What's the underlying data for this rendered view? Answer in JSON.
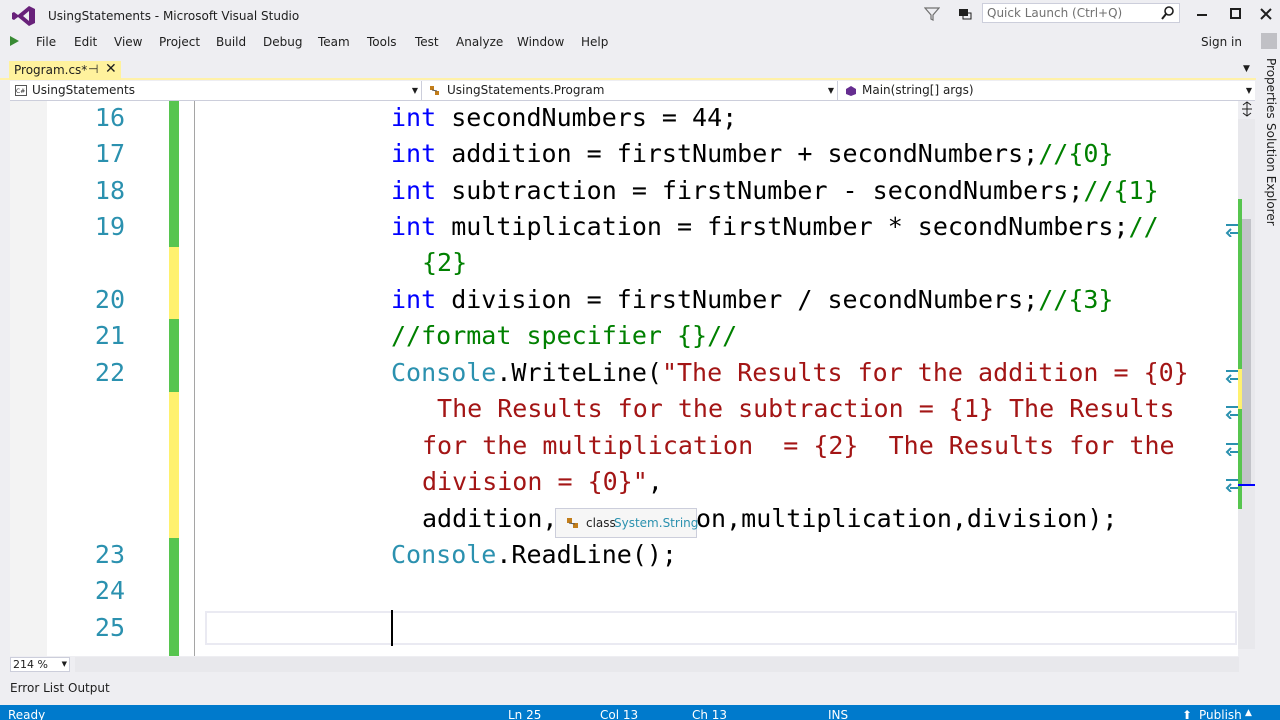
{
  "window": {
    "title": "UsingStatements - Microsoft Visual Studio",
    "quick_launch_placeholder": "Quick Launch (Ctrl+Q)"
  },
  "menu": [
    "File",
    "Edit",
    "View",
    "Project",
    "Build",
    "Debug",
    "Team",
    "Tools",
    "Test",
    "Analyze",
    "Window",
    "Help"
  ],
  "signin": "Sign in",
  "tab": {
    "label": "Program.cs*",
    "pin": "⊣",
    "close": "✕"
  },
  "navbar": {
    "project": "UsingStatements",
    "class": "UsingStatements.Program",
    "member": "Main(string[] args)"
  },
  "line_numbers": [
    "16",
    "17",
    "18",
    "19",
    "20",
    "21",
    "22",
    "23",
    "24",
    "25"
  ],
  "code": {
    "l16": {
      "kw": "int",
      "rest": " secondNumbers = 44;"
    },
    "l17": {
      "kw": "int",
      "rest": " addition = firstNumber + secondNumbers;",
      "cm": "//{0}"
    },
    "l18": {
      "kw": "int",
      "rest": " subtraction = firstNumber - secondNumbers;",
      "cm": "//{1}"
    },
    "l19": {
      "kw": "int",
      "rest": " multiplication = firstNumber * secondNumbers;",
      "cm": "//",
      "cm2": "{2}"
    },
    "l20": {
      "kw": "int",
      "rest": " division = firstNumber / secondNumbers;",
      "cm": "//{3}"
    },
    "l21": {
      "cm": "//format specifier {}//"
    },
    "l22": {
      "ty": "Console",
      "method": ".WriteLine(",
      "s1": "\"The Results for the addition = {0}",
      "s2": " The Results for the subtraction = {1} The Results",
      "s3": "for the multiplication  = {2}  The Results for the",
      "s4": "division = {0}\"",
      "s4b": ",",
      "args_a": "addition,",
      "args_b": "on,multiplication,division);"
    },
    "l23": {
      "ty": "Console",
      "rest": ".ReadLine();"
    }
  },
  "tooltip": {
    "keyword": "class",
    "type": "System.String"
  },
  "zoom": "214 %",
  "bottom_tabs": [
    "Error List",
    "Output"
  ],
  "status": {
    "ready": "Ready",
    "ln": "Ln 25",
    "col": "Col 13",
    "ch": "Ch 13",
    "ins": "INS",
    "publish": "Publish"
  },
  "side_panels": [
    "Properties",
    "Solution Explorer"
  ],
  "colors": {
    "keyword": "#0000ff",
    "type": "#2b91af",
    "comment": "#008000",
    "string": "#a31515",
    "status_bar": "#007acc",
    "saved_change": "#57c54f",
    "unsaved_change": "#fff16e"
  },
  "icons": [
    "vs-logo-icon",
    "filter-icon",
    "feedback-icon",
    "search-icon",
    "minimize-icon",
    "maximize-icon",
    "close-icon",
    "start-icon",
    "pin-icon",
    "class-icon",
    "method-icon",
    "word-wrap-icon",
    "split-icon",
    "publish-icon"
  ]
}
